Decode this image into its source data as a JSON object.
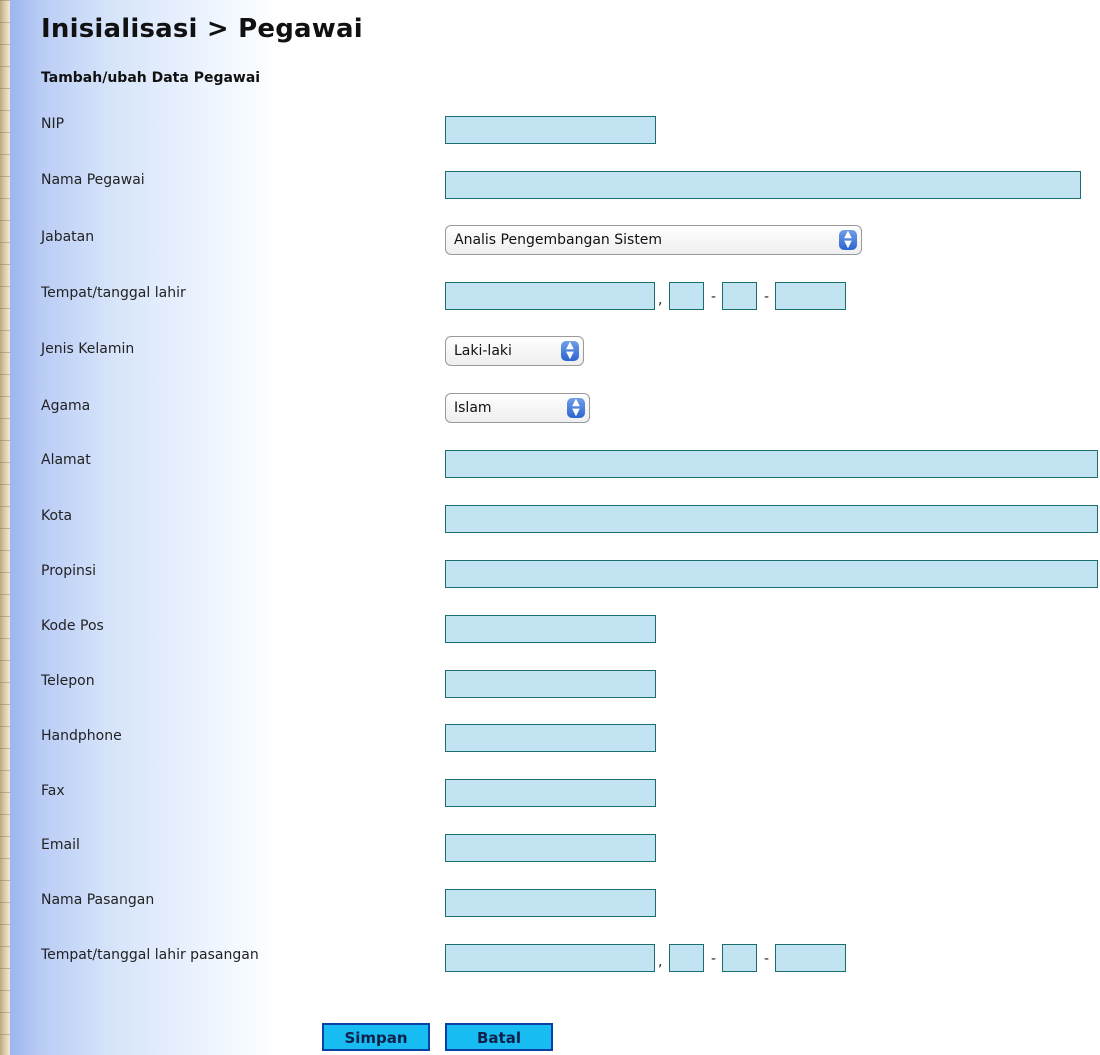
{
  "page": {
    "title": "Inisialisasi > Pegawai",
    "subtitle": "Tambah/ubah Data Pegawai"
  },
  "form": {
    "nip": {
      "label": "NIP",
      "value": ""
    },
    "nama": {
      "label": "Nama Pegawai",
      "value": ""
    },
    "jabatan": {
      "label": "Jabatan",
      "selected": "Analis Pengembangan Sistem"
    },
    "ttl": {
      "label": "Tempat/tanggal lahir",
      "tempat": "",
      "tgl": "",
      "bln": "",
      "thn": "",
      "comma": ",",
      "dash": "-"
    },
    "jenis_kelamin": {
      "label": "Jenis Kelamin",
      "selected": "Laki-laki"
    },
    "agama": {
      "label": "Agama",
      "selected": "Islam"
    },
    "alamat": {
      "label": "Alamat",
      "value": ""
    },
    "kota": {
      "label": "Kota",
      "value": ""
    },
    "propinsi": {
      "label": "Propinsi",
      "value": ""
    },
    "kode_pos": {
      "label": "Kode Pos",
      "value": ""
    },
    "telepon": {
      "label": "Telepon",
      "value": ""
    },
    "handphone": {
      "label": "Handphone",
      "value": ""
    },
    "fax": {
      "label": "Fax",
      "value": ""
    },
    "email": {
      "label": "Email",
      "value": ""
    },
    "nama_pasangan": {
      "label": "Nama Pasangan",
      "value": ""
    },
    "ttl_pasangan": {
      "label": "Tempat/tanggal lahir pasangan",
      "tempat": "",
      "tgl": "",
      "bln": "",
      "thn": "",
      "comma": ",",
      "dash": "-"
    }
  },
  "buttons": {
    "simpan": "Simpan",
    "batal": "Batal"
  },
  "icons": {
    "select_arrow": "updown-chevron-icon"
  },
  "colors": {
    "field_bg": "#c2e4f2",
    "field_border": "#1a6e6e",
    "button_bg": "#17bdf2",
    "button_border": "#0a3fa6"
  }
}
